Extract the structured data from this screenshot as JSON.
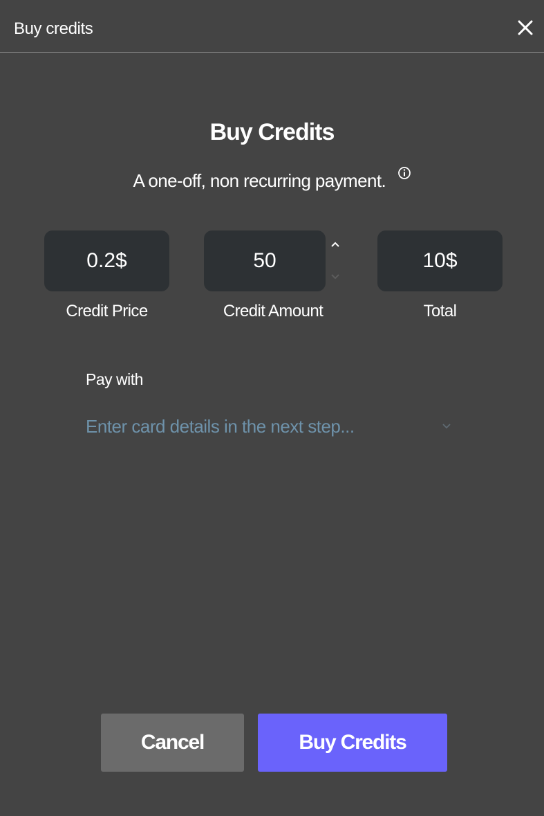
{
  "header": {
    "title": "Buy credits",
    "close_icon": "close-icon"
  },
  "main": {
    "heading": "Buy Credits",
    "subtitle": "A one-off, non recurring payment.",
    "info_icon": "info-icon",
    "fields": {
      "price": {
        "value": "0.2$",
        "label": "Credit Price"
      },
      "amount": {
        "value": "50",
        "label": "Credit Amount"
      },
      "total": {
        "value": "10$",
        "label": "Total"
      }
    },
    "pay_with": {
      "label": "Pay with",
      "selected": "Enter card details in the next step...",
      "chevron_icon": "chevron-down-icon"
    }
  },
  "footer": {
    "cancel_label": "Cancel",
    "buy_label": "Buy Credits"
  },
  "colors": {
    "background": "#444444",
    "field_background": "#2d3134",
    "accent": "#6a63fb",
    "cancel_button": "#6b6b6b",
    "select_text": "#6e92aa"
  }
}
